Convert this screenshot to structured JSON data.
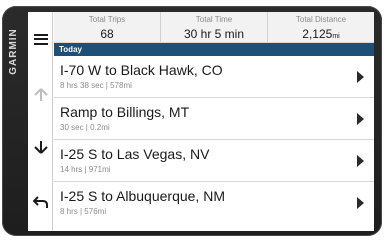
{
  "device": {
    "brand": "GARMIN"
  },
  "stats": [
    {
      "label": "Total Trips",
      "value": "68",
      "unit": ""
    },
    {
      "label": "Total Time",
      "value": "30 hr 5 min",
      "unit": ""
    },
    {
      "label": "Total Distance",
      "value": "2,125",
      "unit": "mi"
    }
  ],
  "section": {
    "label": "Today"
  },
  "trips": [
    {
      "title": "I-70 W to Black Hawk, CO",
      "detail": "8 hrs  38 sec | 578mi"
    },
    {
      "title": "Ramp to Billings, MT",
      "detail": "30 sec | 0.2mi"
    },
    {
      "title": "I-25 S to Las Vegas, NV",
      "detail": "14 hrs | 971mi"
    },
    {
      "title": "I-25 S to Albuquerque, NM",
      "detail": "8 hrs  | 576mi"
    }
  ],
  "colors": {
    "section_bar": "#1d4f77",
    "bezel": "#222222",
    "disabled_icon": "#bdbdbd"
  }
}
